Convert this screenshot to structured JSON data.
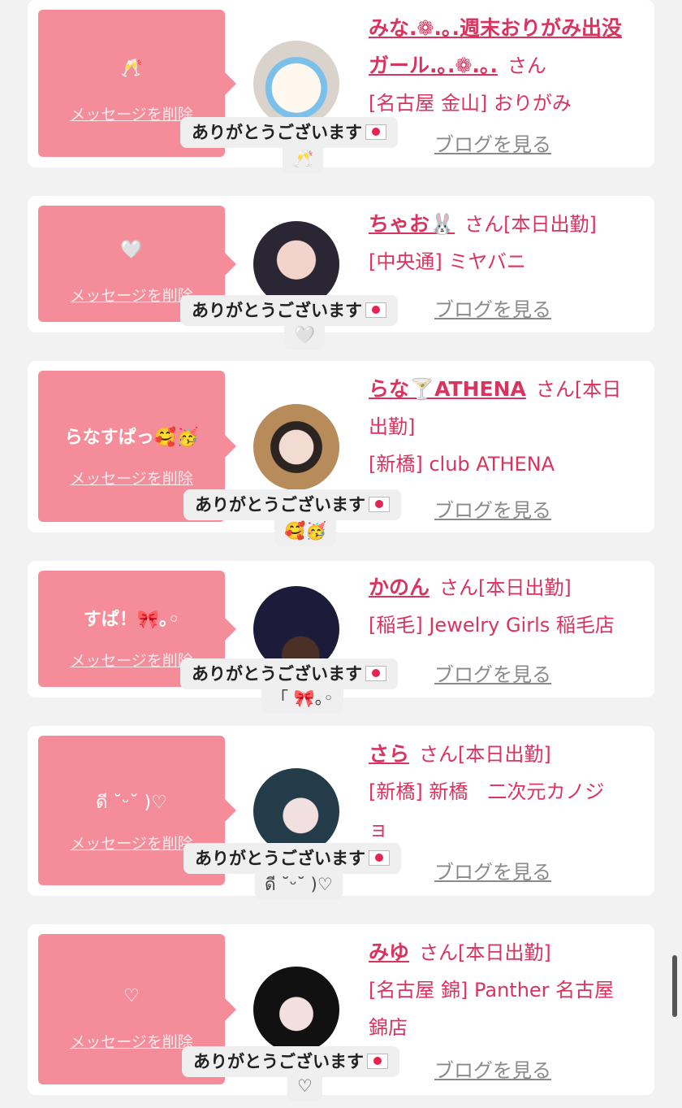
{
  "common": {
    "delete_label": "メッセージを削除",
    "thanks_label": "ありがとうございます",
    "blog_label": "ブログを見る"
  },
  "entries": [
    {
      "message": "🥂",
      "name_line1": "みな.❁.｡.週末おりがみ出没",
      "name_line2": "ガール.｡.❁.｡.",
      "honorific": "さん",
      "status": "",
      "shop": "[名古屋 金山] おりがみ",
      "shop_line2": "",
      "echo": "🥂"
    },
    {
      "message": "🤍",
      "name_line1": "ちゃお🐰",
      "name_line2": "",
      "honorific": "さん",
      "status": "[本日出勤]",
      "shop": "[中央通] ミヤバニ",
      "shop_line2": "",
      "echo": "🤍"
    },
    {
      "message": "らなすぱっ🥰🥳",
      "name_line1": "らな🍸ATHENA",
      "name_line2": "",
      "honorific": "さん",
      "status": "[本日出勤]",
      "shop": "[新橋] club ATHENA",
      "shop_line2": "",
      "echo": "🥰🥳"
    },
    {
      "message": "すぱ！🎀｡◦",
      "name_line1": "かのん",
      "name_line2": "",
      "honorific": "さん",
      "status": "[本日出勤]",
      "shop": "[稲毛] Jewelry Girls 稲毛店",
      "shop_line2": "",
      "echo": "「 🎀｡◦"
    },
    {
      "message": "ดี ˘ᵕ˘ )♡",
      "name_line1": "さら",
      "name_line2": "",
      "honorific": "さん",
      "status": "[本日出勤]",
      "shop": "[新橋] 新橋　二次元カノジ",
      "shop_line2": "ョ",
      "echo": "ดี ˘ᵕ˘ )♡"
    },
    {
      "message": "♡",
      "name_line1": "みゆ",
      "name_line2": "",
      "honorific": "さん",
      "status": "[本日出勤]",
      "shop": "[名古屋 錦] Panther 名古屋",
      "shop_line2": "錦店",
      "echo": "♡"
    }
  ]
}
